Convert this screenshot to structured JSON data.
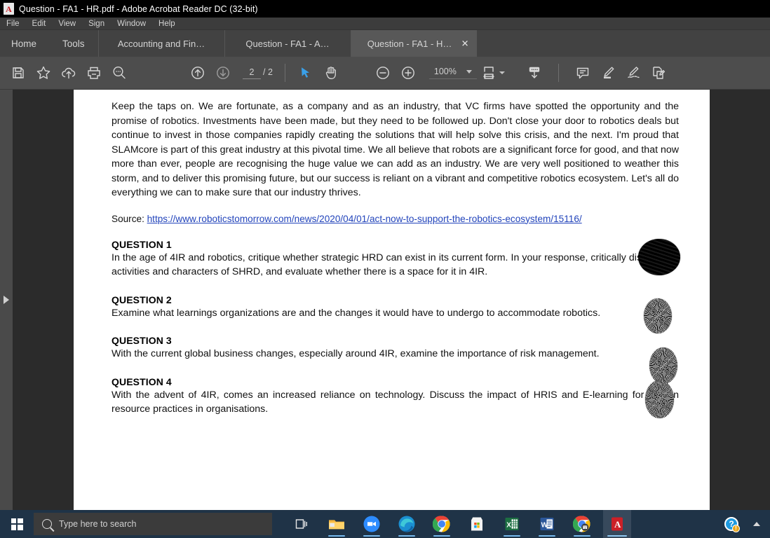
{
  "window": {
    "title": "Question - FA1 - HR.pdf - Adobe Acrobat Reader DC (32-bit)",
    "app_icon": "pdf-document-icon",
    "icon_letter": "A"
  },
  "menubar": {
    "items": [
      {
        "label": "File"
      },
      {
        "label": "Edit"
      },
      {
        "label": "View"
      },
      {
        "label": "Sign"
      },
      {
        "label": "Window"
      },
      {
        "label": "Help"
      }
    ]
  },
  "tabs": {
    "home": "Home",
    "tools": "Tools",
    "documents": [
      {
        "label": "Accounting and Fin…",
        "active": false
      },
      {
        "label": "Question - FA1 - A…",
        "active": false
      },
      {
        "label": "Question - FA1 - H…",
        "active": true
      }
    ],
    "close_glyph": "✕"
  },
  "toolbar": {
    "icons": [
      {
        "name": "save-icon",
        "title": "Save"
      },
      {
        "name": "star-icon",
        "title": "Add to favourites"
      },
      {
        "name": "cloud-upload-icon",
        "title": "Upload"
      },
      {
        "name": "print-icon",
        "title": "Print"
      },
      {
        "name": "zoom-search-icon",
        "title": "Find"
      },
      {
        "name": "page-up-icon",
        "title": "Previous page"
      },
      {
        "name": "page-down-icon",
        "title": "Next page"
      },
      {
        "name": "select-tool-icon",
        "title": "Select tool"
      },
      {
        "name": "hand-tool-icon",
        "title": "Hand tool"
      },
      {
        "name": "zoom-out-icon",
        "title": "Zoom out"
      },
      {
        "name": "zoom-in-icon",
        "title": "Zoom in"
      },
      {
        "name": "fit-page-icon",
        "title": "Fit page"
      },
      {
        "name": "scroll-mode-icon",
        "title": "Page display"
      },
      {
        "name": "comment-icon",
        "title": "Add comment"
      },
      {
        "name": "highlight-icon",
        "title": "Highlight text"
      },
      {
        "name": "sign-icon",
        "title": "Fill and sign"
      },
      {
        "name": "request-signature-icon",
        "title": "Request e-signatures"
      }
    ],
    "page_current": "2",
    "page_total": "/ 2",
    "zoom_value": "100%",
    "active_tool": "select-tool-icon",
    "accent_color": "#3aa0e8"
  },
  "navpane": {
    "expand_label": "Show navigation pane"
  },
  "document": {
    "paragraph": "Keep the taps on. We are fortunate, as a company and as an industry, that VC firms have spotted the opportunity and the promise of robotics. Investments have been made, but they need to be followed up. Don't close your door to robotics deals but continue to invest in those companies rapidly creating the solutions that will help solve this crisis, and the next. I'm proud that SLAMcore is part of this great industry at this pivotal time. We all believe that robots are a significant force for good, and that now more than ever, people are recognising the huge value we can add as an industry. We are very well positioned to weather this storm, and to deliver this promising future, but our success is reliant on a vibrant and competitive robotics ecosystem. Let's all do everything we can to make sure that our industry thrives.",
    "source_label": "Source: ",
    "source_url": "https://www.roboticstomorrow.com/news/2020/04/01/act-now-to-support-the-robotics-ecosystem/15116/",
    "questions": [
      {
        "heading": "QUESTION 1",
        "text": "In the age of 4IR and robotics, critique whether strategic HRD can exist in its current form. In your response, critically discuss the activities and characters of SHRD, and evaluate whether there is a space for it in 4IR."
      },
      {
        "heading": "QUESTION 2",
        "text": "Examine what learnings organizations are and the changes it would have to undergo to accommodate robotics."
      },
      {
        "heading": "QUESTION 3",
        "text": "With the current global business changes, especially around 4IR, examine the importance of risk management."
      },
      {
        "heading": "QUESTION 4",
        "text": "With the advent of 4IR, comes an increased reliance on technology. Discuss the impact of HRIS and E-learning for human resource practices in organisations."
      }
    ],
    "annotations": [
      {
        "name": "scribble-blob-1",
        "style": "dense"
      },
      {
        "name": "scribble-blob-2",
        "style": "sparse"
      },
      {
        "name": "scribble-blob-3",
        "style": "sparse"
      },
      {
        "name": "scribble-blob-4",
        "style": "sparse"
      }
    ]
  },
  "taskbar": {
    "start_label": "Start",
    "search_placeholder": "Type here to search",
    "icons": [
      {
        "name": "task-view-icon",
        "label": "Task View"
      },
      {
        "name": "file-explorer-icon",
        "label": "File Explorer"
      },
      {
        "name": "zoom-app-icon",
        "label": "Zoom"
      },
      {
        "name": "microsoft-edge-icon",
        "label": "Microsoft Edge"
      },
      {
        "name": "google-chrome-icon",
        "label": "Google Chrome"
      },
      {
        "name": "microsoft-store-icon",
        "label": "Microsoft Store"
      },
      {
        "name": "microsoft-excel-icon",
        "label": "Excel"
      },
      {
        "name": "microsoft-word-icon",
        "label": "Word"
      },
      {
        "name": "chrome-incognito-icon",
        "label": "Chrome"
      },
      {
        "name": "adobe-acrobat-icon",
        "label": "Adobe Acrobat Reader DC"
      }
    ],
    "tray": {
      "help_glyph": "?",
      "badge_glyph": "!",
      "chevron_label": "Show hidden icons"
    }
  }
}
